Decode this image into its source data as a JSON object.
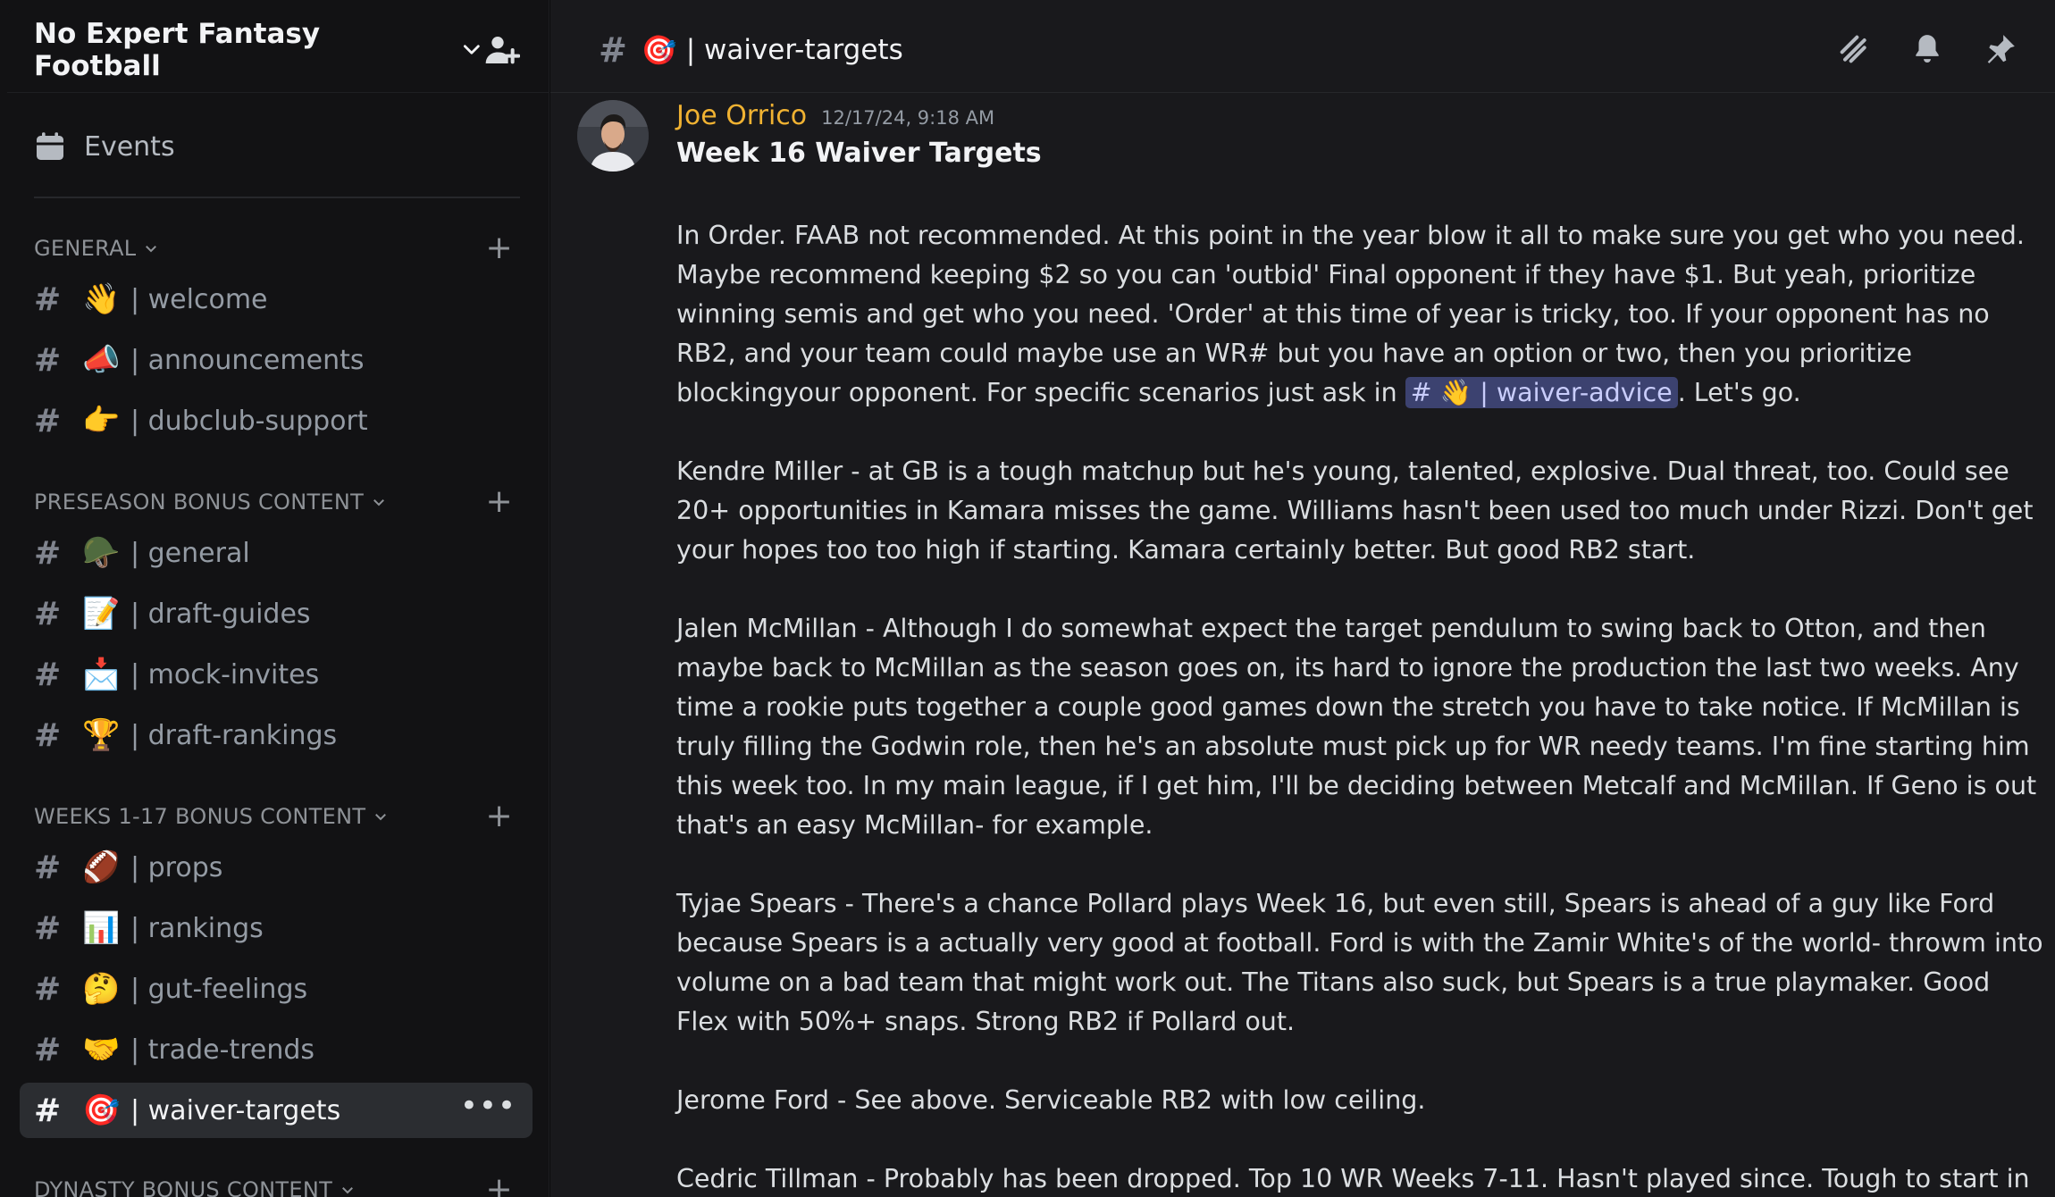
{
  "server": {
    "name": "No Expert Fantasy Football"
  },
  "sidebar": {
    "events_label": "Events",
    "categories": [
      {
        "name": "GENERAL"
      },
      {
        "name": "PRESEASON BONUS CONTENT"
      },
      {
        "name": "WEEKS 1-17 BONUS CONTENT"
      },
      {
        "name": "DYNASTY BONUS CONTENT"
      }
    ],
    "channels": [
      {
        "emoji": "👋",
        "label": "| welcome"
      },
      {
        "emoji": "📣",
        "label": "| announcements"
      },
      {
        "emoji": "👉",
        "label": "| dubclub-support"
      },
      {
        "emoji": "🪖",
        "label": "| general"
      },
      {
        "emoji": "📝",
        "label": "| draft-guides"
      },
      {
        "emoji": "📩",
        "label": "| mock-invites"
      },
      {
        "emoji": "🏆",
        "label": "| draft-rankings"
      },
      {
        "emoji": "🏈",
        "label": "| props"
      },
      {
        "emoji": "📊",
        "label": "| rankings"
      },
      {
        "emoji": "🤔",
        "label": "| gut-feelings"
      },
      {
        "emoji": "🤝",
        "label": "| trade-trends"
      },
      {
        "emoji": "🎯",
        "label": "| waiver-targets"
      }
    ]
  },
  "topbar": {
    "emoji": "🎯",
    "channel_label": "| waiver-targets"
  },
  "message": {
    "author": "Joe Orrico",
    "timestamp": "12/17/24, 9:18 AM",
    "title": "Week 16 Waiver Targets",
    "p1_before": "In Order. FAAB not recommended. At this point in the year blow it all to make sure you get who you need. Maybe recommend keeping $2 so you can 'outbid' Final opponent if they have $1. But yeah, prioritize winning semis and get who you need. 'Order' at this time of year is tricky, too. If your opponent has no RB2, and your team could maybe use an WR# but you have an option or two, then you prioritize blockingyour opponent. For specific scenarios just ask in ",
    "p1_mention": "# 👋 | waiver-advice",
    "p1_after": ". Let's go.",
    "paragraphs": [
      "Kendre Miller - at GB is a tough matchup but he's young, talented, explosive. Dual threat, too. Could see 20+ opportunities in Kamara misses the game. Williams hasn't been used too much under Rizzi. Don't get your hopes too too high if starting. Kamara certainly better. But good RB2 start.",
      "Jalen McMillan - Although I do somewhat expect the target pendulum to swing back to Otton, and then maybe back to McMillan as the season goes on, its hard to ignore the production the last two weeks. Any time a rookie puts together a couple good games down the stretch you have to take notice. If McMillan is truly filling the Godwin role, then he's an absolute must pick up for WR needy teams. I'm fine starting him this week too. In my main league, if I get him, I'll be deciding between Metcalf and McMillan. If Geno is out that's an easy McMillan- for example.",
      "Tyjae Spears - There's a chance Pollard plays Week 16, but even still, Spears is ahead of a guy like Ford because Spears is a actually very good at football. Ford is with the Zamir White's of the world- throwm into volume on a bad team that might work out. The Titans also suck, but Spears is a true playmaker. Good Flex with 50%+ snaps. Strong RB2 if Pollard out.",
      "Jerome Ford - See above. Serviceable RB2 with low ceiling.",
      "Cedric Tillman - Probably has been dropped. Top 10 WR Weeks 7-11. Hasn't played since. Tough to start in Week"
    ]
  },
  "colors": {
    "author": "#f0b232",
    "mention_bg": "#3c4270",
    "mention_text": "#c9cdfb",
    "active_channel": "#2b2d31"
  }
}
